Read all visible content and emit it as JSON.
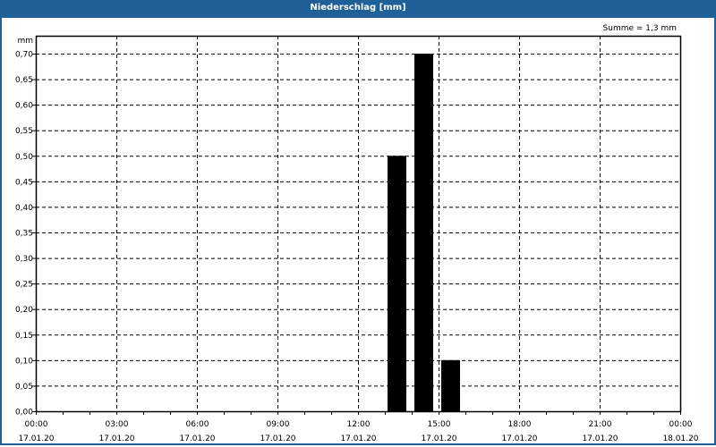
{
  "chart_data": {
    "type": "bar",
    "title": "Niederschlag [mm]",
    "ylabel": "mm",
    "annotation": "Summe = 1,3 mm",
    "ylim": [
      0,
      0.75
    ],
    "yticks": [
      "0,00",
      "0,05",
      "0,10",
      "0,15",
      "0,20",
      "0,25",
      "0,30",
      "0,35",
      "0,40",
      "0,45",
      "0,50",
      "0,55",
      "0,60",
      "0,65",
      "0,70"
    ],
    "xlim_hours": [
      0,
      24
    ],
    "xticks": [
      {
        "time": "00:00",
        "date": "17.01.20"
      },
      {
        "time": "03:00",
        "date": "17.01.20"
      },
      {
        "time": "06:00",
        "date": "17.01.20"
      },
      {
        "time": "09:00",
        "date": "17.01.20"
      },
      {
        "time": "12:00",
        "date": "17.01.20"
      },
      {
        "time": "15:00",
        "date": "17.01.20"
      },
      {
        "time": "18:00",
        "date": "17.01.20"
      },
      {
        "time": "21:00",
        "date": "17.01.20"
      },
      {
        "time": "00:00",
        "date": "18.01.20"
      }
    ],
    "bars": [
      {
        "hour_start": 13,
        "value": 0.5
      },
      {
        "hour_start": 14,
        "value": 0.7
      },
      {
        "hour_start": 15,
        "value": 0.1
      }
    ],
    "bar_color": "#000000",
    "grid": true
  }
}
